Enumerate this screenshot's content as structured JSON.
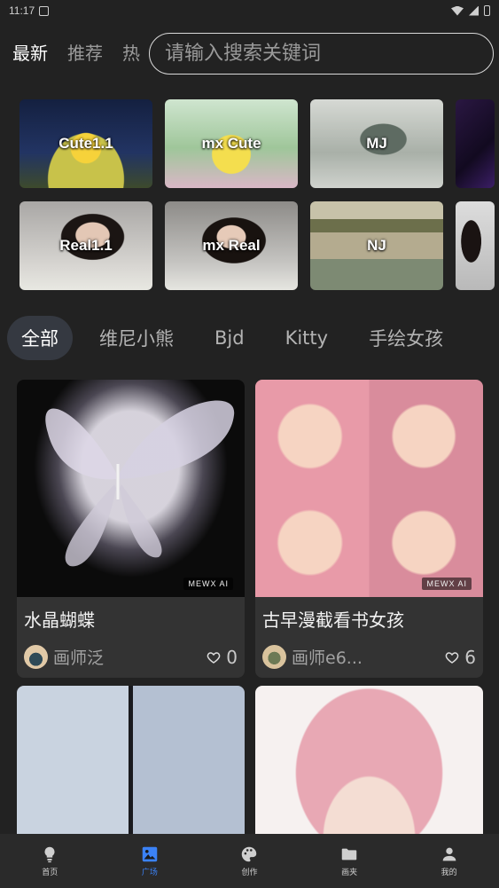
{
  "status_bar": {
    "time": "11:17"
  },
  "top_tabs": [
    {
      "label": "最新",
      "active": true
    },
    {
      "label": "推荐",
      "active": false
    },
    {
      "label": "热",
      "active": false
    }
  ],
  "search": {
    "placeholder": "请输入搜索关键词"
  },
  "models": [
    {
      "label": "Cute1.1"
    },
    {
      "label": "mx Cute"
    },
    {
      "label": "MJ"
    },
    {
      "label": ""
    },
    {
      "label": "Real1.1"
    },
    {
      "label": "mx Real"
    },
    {
      "label": "NJ"
    },
    {
      "label": ""
    }
  ],
  "categories": [
    {
      "label": "全部",
      "active": true
    },
    {
      "label": "维尼小熊",
      "active": false
    },
    {
      "label": "Bjd",
      "active": false
    },
    {
      "label": "Kitty",
      "active": false
    },
    {
      "label": "手绘女孩",
      "active": false
    }
  ],
  "cards": [
    {
      "title": "水晶蝴蝶",
      "author": "画师泛",
      "likes": "0",
      "watermark": "MEWX AI"
    },
    {
      "title": "古早漫截看书女孩",
      "author": "画师e6...",
      "likes": "6",
      "watermark": "MEWX AI"
    },
    {
      "title": "",
      "author": "",
      "likes": ""
    },
    {
      "title": "",
      "author": "",
      "likes": ""
    }
  ],
  "bottom_nav": [
    {
      "label": "首页",
      "icon": "bulb-icon",
      "active": false
    },
    {
      "label": "广场",
      "icon": "image-icon",
      "active": true
    },
    {
      "label": "创作",
      "icon": "palette-icon",
      "active": false
    },
    {
      "label": "画夹",
      "icon": "folder-icon",
      "active": false
    },
    {
      "label": "我的",
      "icon": "person-icon",
      "active": false
    }
  ],
  "colors": {
    "background": "#222222",
    "card": "#333333",
    "accent": "#3b82f6",
    "chip_active": "#353941"
  }
}
